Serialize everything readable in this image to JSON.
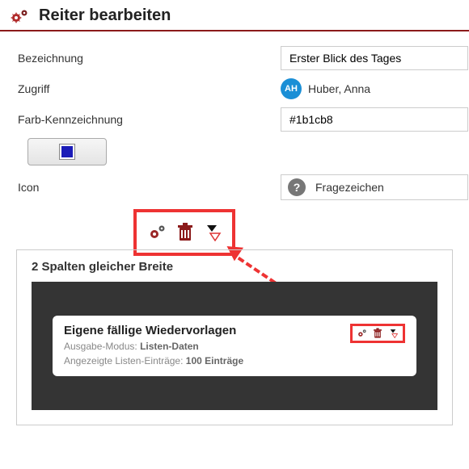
{
  "header": {
    "title": "Reiter bearbeiten"
  },
  "fields": {
    "name_label": "Bezeichnung",
    "name_value": "Erster Blick des Tages",
    "access_label": "Zugriff",
    "user_initials": "AH",
    "user_name": "Huber, Anna",
    "color_label": "Farb-Kennzeichnung",
    "color_value": "#1b1cb8",
    "icon_label": "Icon",
    "icon_value": "Fragezeichen"
  },
  "dashboard": {
    "layout_title": "2 Spalten gleicher Breite",
    "widget_title": "Eigene fällige Wiedervorlagen",
    "mode_label": "Ausgabe-Modus: ",
    "mode_value": "Listen-Daten",
    "entries_label": "Angezeigte Listen-Einträge: ",
    "entries_value": "100 Einträge"
  }
}
